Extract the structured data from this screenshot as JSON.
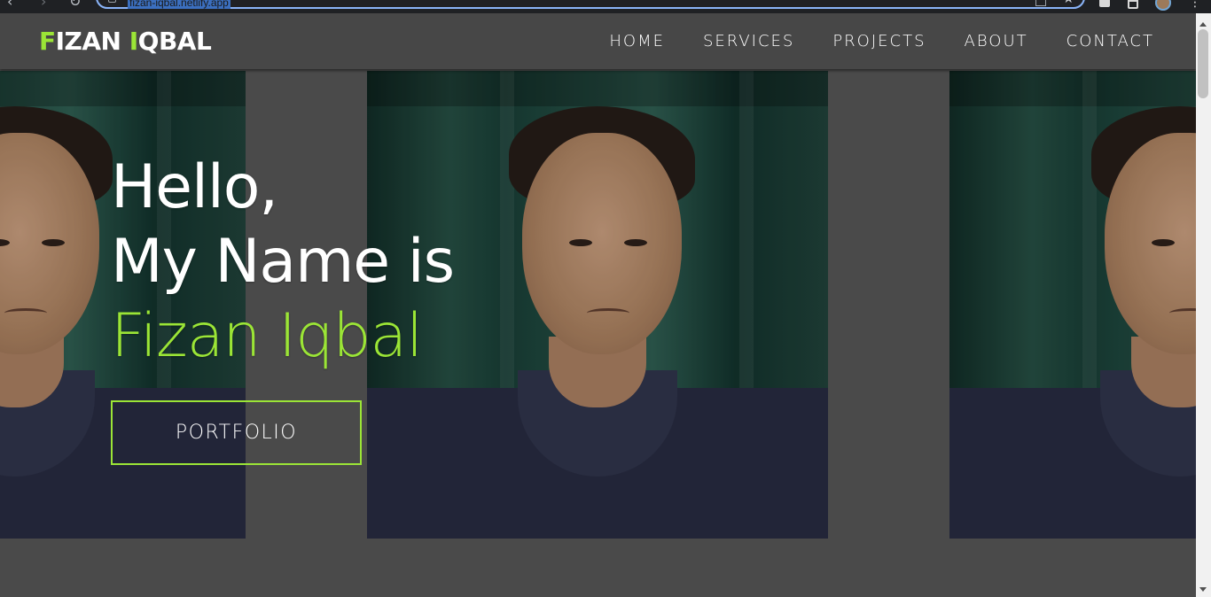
{
  "browser": {
    "url": "fizan-iqbal.netlify.app"
  },
  "site": {
    "logo": {
      "first_letter": "F",
      "first_rest": "IZAN ",
      "second_letter": "I",
      "second_rest": "QBAL"
    },
    "nav": [
      {
        "label": "HOME"
      },
      {
        "label": "SERVICES"
      },
      {
        "label": "PROJECTS"
      },
      {
        "label": "ABOUT"
      },
      {
        "label": "CONTACT"
      }
    ]
  },
  "hero": {
    "line1": "Hello,",
    "line2": "My Name is",
    "name": "Fizan Iqbal",
    "button": "PORTFOLIO"
  },
  "colors": {
    "accent": "#9be536",
    "navbar": "#474747",
    "background": "#4a4a4a"
  }
}
